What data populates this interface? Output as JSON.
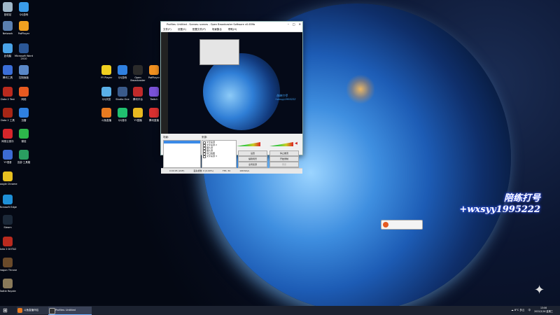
{
  "desktop": {
    "left_icons": [
      {
        "label": "回收站",
        "color": "#9fb7c9"
      },
      {
        "label": "QQ游戏",
        "color": "#3a9be8"
      },
      {
        "label": "Network",
        "color": "#5a7fb0"
      },
      {
        "label": "PotPlayer",
        "color": "#f0a020"
      },
      {
        "label": "此电脑",
        "color": "#4aa3e8"
      },
      {
        "label": "Microsoft Word 2010",
        "color": "#2b5797"
      },
      {
        "label": "腾讯工具",
        "color": "#3a6ed8"
      },
      {
        "label": "控制面板",
        "color": "#5a88c8"
      },
      {
        "label": "Dota 2 Test",
        "color": "#b92a1e"
      },
      {
        "label": "网络",
        "color": "#e85a20"
      },
      {
        "label": "Dota 2 工具",
        "color": "#a82616"
      },
      {
        "label": "迅雷",
        "color": "#2f80e0"
      },
      {
        "label": "网易云音乐",
        "color": "#d8262b"
      },
      {
        "label": "微信",
        "color": "#2db84b"
      },
      {
        "label": "YY语音",
        "color": "#3c6bd3"
      },
      {
        "label": "迅游·工具箱",
        "color": "#2a9d60"
      },
      {
        "label": "Google Chrome",
        "color": "#e8c020"
      },
      {
        "label": "Microsoft Edge",
        "color": "#1e90d8"
      },
      {
        "label": "Steam",
        "color": "#1b2838"
      },
      {
        "label": "Dota 2 DOTA2",
        "color": "#b92a1e"
      },
      {
        "label": "Dragon Throne",
        "color": "#6a4a2a"
      },
      {
        "label": "Battle Royale",
        "color": "#8a7a5a"
      }
    ],
    "mid_icons": [
      {
        "label": "YY Player",
        "color": "#f0d020"
      },
      {
        "label": "QQ游戏",
        "color": "#2f80e0"
      },
      {
        "label": "Open Broadcaster",
        "color": "#2a2a2a"
      },
      {
        "label": "PotPlayer",
        "color": "#f09020"
      },
      {
        "label": "QQ浏览",
        "color": "#5ab0e8"
      },
      {
        "label": "Studio One",
        "color": "#3a5a8a"
      },
      {
        "label": "腾讯平台",
        "color": "#c02a2a"
      },
      {
        "label": "Twitch",
        "color": "#7a52d8"
      },
      {
        "label": "斗鱼直播",
        "color": "#e87a20"
      },
      {
        "label": "QQ音乐",
        "color": "#20c070"
      },
      {
        "label": "YY直播",
        "color": "#e8b820"
      },
      {
        "label": "腾讯直播",
        "color": "#d83030"
      }
    ]
  },
  "obs": {
    "title": "Profiles: Untitled - Scenes: scenes - Open Broadcaster Software v0.659b",
    "menus": [
      "文件(F)",
      "设置(S)",
      "配置文件(P)",
      "场景集合",
      "帮助(H)"
    ],
    "preview_text": "陪练打号",
    "preview_text2": "+wxsyy1995222",
    "scenes_label": "场景:",
    "sources_label": "来源:",
    "sources": [
      "文字来源",
      "文字来源 2",
      "图片源",
      "图片源",
      "窗口截图",
      "文字来源 3"
    ],
    "buttons": {
      "settings": "设置",
      "stop_stream": "停止推流",
      "preview": "预览",
      "plugins": "插件",
      "global_sources": "全局来源",
      "exit": "退出",
      "edit_scene": "编辑场景",
      "start_record": "开始录制"
    },
    "status": [
      "0:00:05 (LIVE)",
      "丢失帧数: 0 (0.00%)",
      "FPS: 30",
      "1663kb/s"
    ]
  },
  "overlay": {
    "line1": "陪练打号",
    "line2": "+wxsyy1995222"
  },
  "taskbar": {
    "tasks": [
      "斗鱼直播伴侣",
      "Profiles: Untitled"
    ],
    "weather": "8°C 多云",
    "ime": "中",
    "time": "13:06",
    "date": "2022/2/16 星期三"
  }
}
